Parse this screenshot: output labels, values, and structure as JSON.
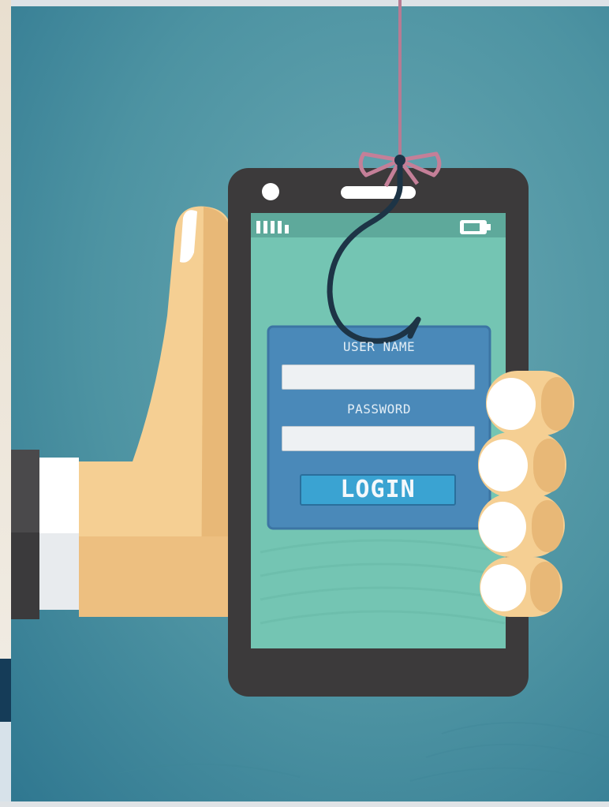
{
  "login": {
    "username_label": "USER NAME",
    "password_label": "PASSWORD",
    "button_label": "LOGIN"
  },
  "colors": {
    "background": "#4f95a3",
    "phone_body": "#3c3a3b",
    "screen": "#74c5b3",
    "login_card": "#4a89b9",
    "login_button": "#3aa3d2",
    "skin": "#f5cf93",
    "fishing_line": "#b77b93",
    "hook": "#1d3446"
  },
  "icons": {
    "signal": "signal-bars-icon",
    "battery": "battery-icon",
    "hook": "fishing-hook-icon",
    "bow": "ribbon-bow-icon"
  }
}
